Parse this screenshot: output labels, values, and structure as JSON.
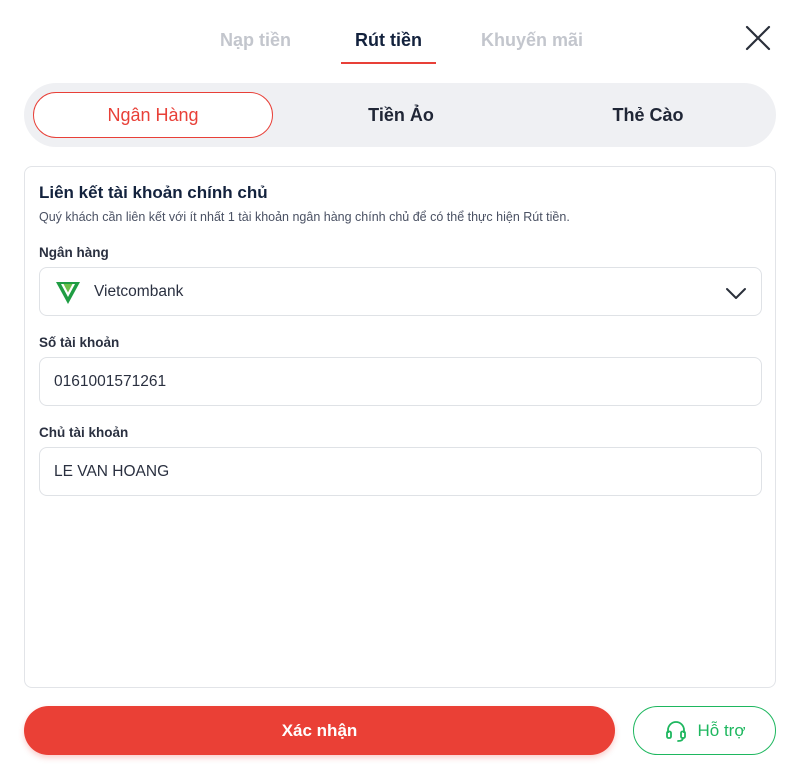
{
  "top_tabs": [
    {
      "label": "Nạp tiền",
      "active": false
    },
    {
      "label": "Rút tiền",
      "active": true
    },
    {
      "label": "Khuyến mãi",
      "active": false
    }
  ],
  "method_tabs": [
    {
      "label": "Ngân Hàng",
      "active": true
    },
    {
      "label": "Tiền Ảo",
      "active": false
    },
    {
      "label": "Thẻ Cào",
      "active": false
    }
  ],
  "card": {
    "title": "Liên kết tài khoản chính chủ",
    "description": "Quý khách cần liên kết với ít nhất 1 tài khoản ngân hàng chính chủ để có thể thực hiện Rút tiền."
  },
  "fields": {
    "bank": {
      "label": "Ngân hàng",
      "value": "Vietcombank",
      "logo_icon": "vietcombank-logo"
    },
    "account_number": {
      "label": "Số tài khoản",
      "value": "0161001571261"
    },
    "account_holder": {
      "label": "Chủ tài khoản",
      "value": "LE VAN HOANG"
    }
  },
  "actions": {
    "confirm_label": "Xác nhận",
    "support_label": "Hỗ trợ",
    "support_icon": "headset-icon"
  },
  "colors": {
    "accent": "#ea4036",
    "support": "#1eb75f",
    "active_text": "#13223d",
    "inactive_text": "#c3c6cd"
  }
}
